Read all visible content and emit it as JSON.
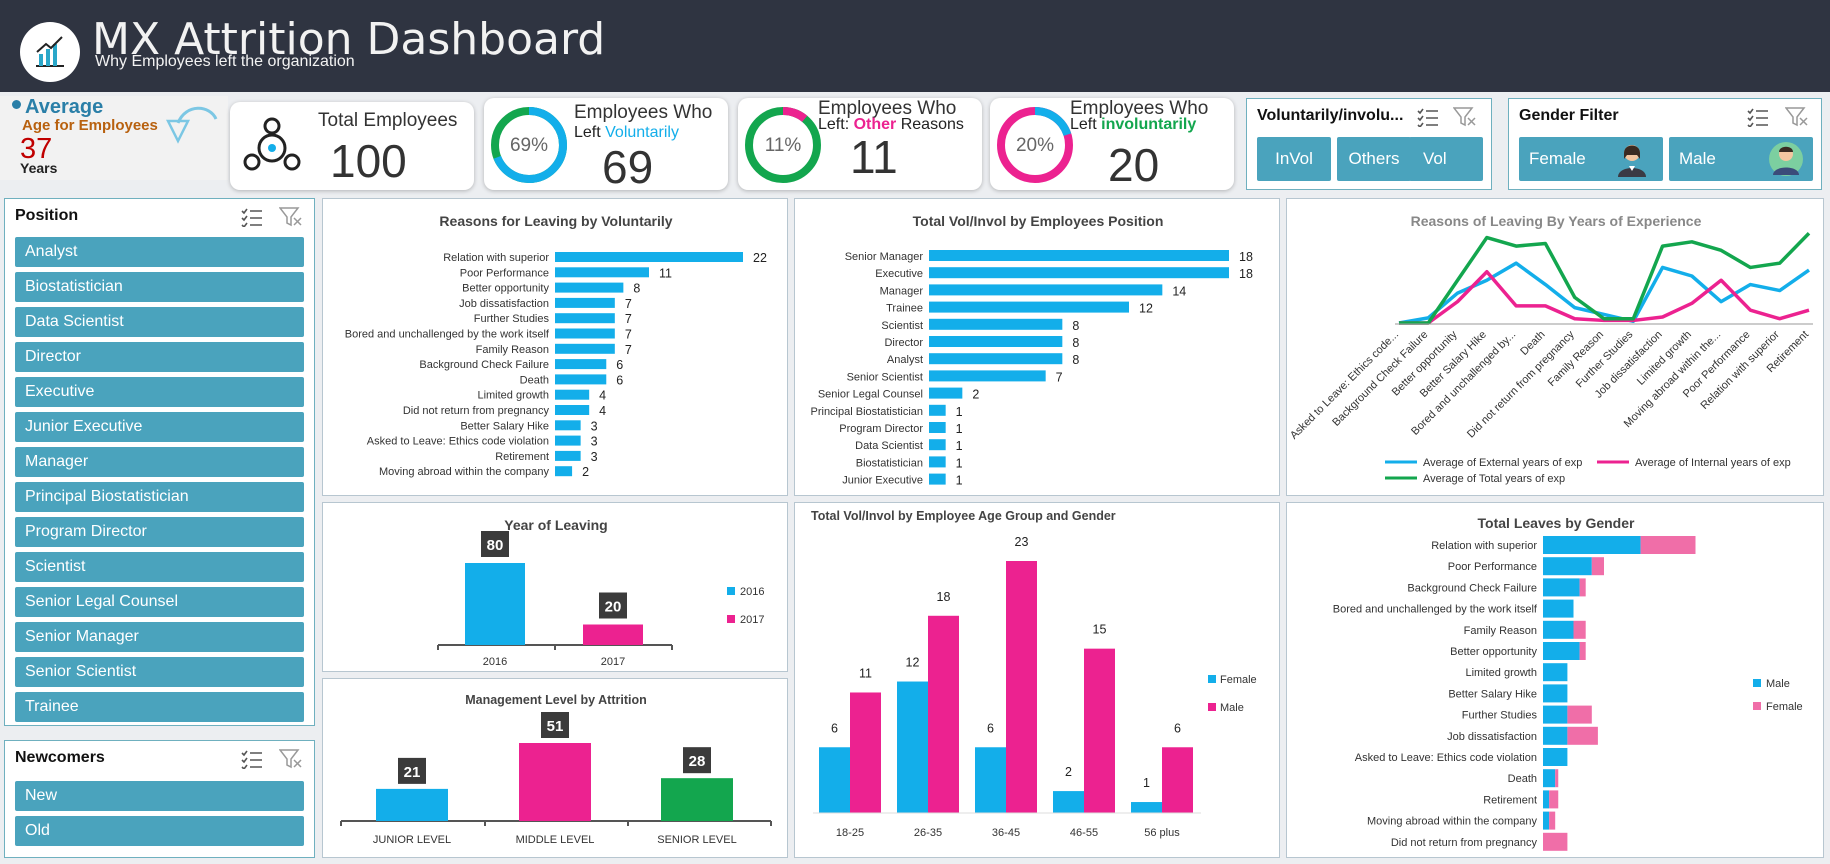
{
  "header": {
    "title": "MX Attrition Dashboard",
    "subtitle": "Why Employees left the organization"
  },
  "avg_age": {
    "label1": "Average",
    "label2": "Age for Employees",
    "value": "37",
    "unit": "Years"
  },
  "kpis": {
    "total": {
      "label": "Total Employees",
      "value": "100"
    },
    "voluntary": {
      "line1": "Employees Who",
      "line2a": "Left",
      "line2b": "Voluntarily",
      "value": "69",
      "pct": "69%",
      "fraction": 0.69
    },
    "other": {
      "line1": "Employees Who",
      "line2a": "Left:",
      "line2b": "Other",
      "line2c": "Reasons",
      "value": "11",
      "pct": "11%",
      "fraction": 0.11
    },
    "involuntary": {
      "line1": "Employees Who",
      "line2a": "Left",
      "line2b": "involuntarily",
      "value": "20",
      "pct": "20%",
      "fraction": 0.2
    }
  },
  "vol_filter": {
    "title": "Voluntarily/involu...",
    "items": [
      "InVol",
      "Others",
      "Vol"
    ]
  },
  "gender_filter": {
    "title": "Gender Filter",
    "items": [
      "Female",
      "Male"
    ]
  },
  "position_slicer": {
    "title": "Position",
    "items": [
      "Analyst",
      "Biostatistician",
      "Data Scientist",
      "Director",
      "Executive",
      "Junior Executive",
      "Manager",
      "Principal Biostatistician",
      "Program Director",
      "Scientist",
      "Senior Legal Counsel",
      "Senior Manager",
      "Senior Scientist",
      "Trainee"
    ]
  },
  "newcomers_slicer": {
    "title": "Newcomers",
    "items": [
      "New",
      "Old"
    ]
  },
  "colors": {
    "blue": "#13aeea",
    "pink": "#ec2290",
    "green": "#13a64e",
    "slicer": "#4aa3bd",
    "header": "#2f3441"
  },
  "chart_data": [
    {
      "id": "reasons_vol",
      "type": "bar",
      "title": "Reasons for Leaving by Voluntarily",
      "categories": [
        "Relation with superior",
        "Poor Performance",
        "Better opportunity",
        "Job dissatisfaction",
        "Further Studies",
        "Bored and unchallenged by the work itself",
        "Family Reason",
        "Background Check Failure",
        "Death",
        "Limited growth",
        "Did not return from pregnancy",
        "Better Salary Hike",
        "Asked to Leave: Ethics code violation",
        "Retirement",
        "Moving abroad within the company"
      ],
      "values": [
        22,
        11,
        8,
        7,
        7,
        7,
        7,
        6,
        6,
        4,
        4,
        3,
        3,
        3,
        2
      ]
    },
    {
      "id": "position",
      "type": "bar",
      "title": "Total Vol/Invol by Employees Position",
      "categories": [
        "Senior Manager",
        "Executive",
        "Manager",
        "Trainee",
        "Scientist",
        "Director",
        "Analyst",
        "Senior Scientist",
        "Senior Legal Counsel",
        "Principal Biostatistician",
        "Program Director",
        "Data Scientist",
        "Biostatistician",
        "Junior Executive"
      ],
      "values": [
        18,
        18,
        14,
        12,
        8,
        8,
        8,
        7,
        2,
        1,
        1,
        1,
        1,
        1
      ]
    },
    {
      "id": "experience",
      "type": "line",
      "title": "Reasons of Leaving By Years of Experience",
      "categories": [
        "Asked to Leave: Ethics code...",
        "Background Check Failure",
        "Better opportunity",
        "Better Salary Hike",
        "Bored and unchallenged by...",
        "Death",
        "Did not return from pregnancy",
        "Family Reason",
        "Further Studies",
        "Job dissatisfaction",
        "Limited growth",
        "Moving abroad within the...",
        "Poor Performance",
        "Relation with superior",
        "Retirement"
      ],
      "series": [
        {
          "name": "Average of External years of exp",
          "values": [
            0,
            0.6,
            3.5,
            5,
            7,
            4.5,
            1.8,
            1,
            0.2,
            6.5,
            5.5,
            2.5,
            4.5,
            3.8,
            6.2
          ]
        },
        {
          "name": "Average of Internal years of exp",
          "values": [
            0,
            0,
            2.5,
            6,
            2,
            2,
            0.5,
            0.3,
            0.3,
            0.7,
            2.3,
            5,
            1.5,
            0.5,
            1.5
          ]
        },
        {
          "name": "Average of Total years of exp",
          "values": [
            0,
            0,
            5,
            10,
            9,
            9.3,
            3,
            0.5,
            0.5,
            9,
            9.5,
            8.5,
            6.5,
            7,
            10.5
          ]
        }
      ]
    },
    {
      "id": "year",
      "type": "bar",
      "title": "Year of Leaving",
      "categories": [
        "2016",
        "2017"
      ],
      "values": [
        80,
        20
      ],
      "legend": [
        "2016",
        "2017"
      ]
    },
    {
      "id": "age_gender",
      "type": "bar",
      "title": "Total Vol/Invol by Employee Age Group and Gender",
      "categories": [
        "18-25",
        "26-35",
        "36-45",
        "46-55",
        "56 plus"
      ],
      "series": [
        {
          "name": "Female",
          "values": [
            6,
            12,
            6,
            2,
            1
          ]
        },
        {
          "name": "Male",
          "values": [
            11,
            18,
            23,
            15,
            6
          ]
        }
      ]
    },
    {
      "id": "management",
      "type": "bar",
      "title": "Management Level by Attrition",
      "categories": [
        "JUNIOR LEVEL",
        "MIDDLE LEVEL",
        "SENIOR LEVEL"
      ],
      "values": [
        21,
        51,
        28
      ]
    },
    {
      "id": "gender_leaves",
      "type": "bar",
      "title": "Total Leaves by Gender",
      "categories": [
        "Relation with superior",
        "Poor Performance",
        "Background Check Failure",
        "Bored and unchallenged by the work itself",
        "Family Reason",
        "Better opportunity",
        "Limited growth",
        "Better Salary Hike",
        "Further Studies",
        "Job dissatisfaction",
        "Asked to Leave: Ethics code violation",
        "Death",
        "Retirement",
        "Moving abroad within the company",
        "Did not return from pregnancy"
      ],
      "series": [
        {
          "name": "Male",
          "values": [
            16,
            8,
            6,
            5,
            5,
            6,
            4,
            4,
            4,
            4,
            4,
            2,
            1,
            1,
            0
          ]
        },
        {
          "name": "Female",
          "values": [
            9,
            2,
            1,
            0,
            2,
            1,
            0,
            0,
            4,
            5,
            0,
            0.5,
            1.5,
            1,
            4
          ]
        }
      ]
    }
  ]
}
